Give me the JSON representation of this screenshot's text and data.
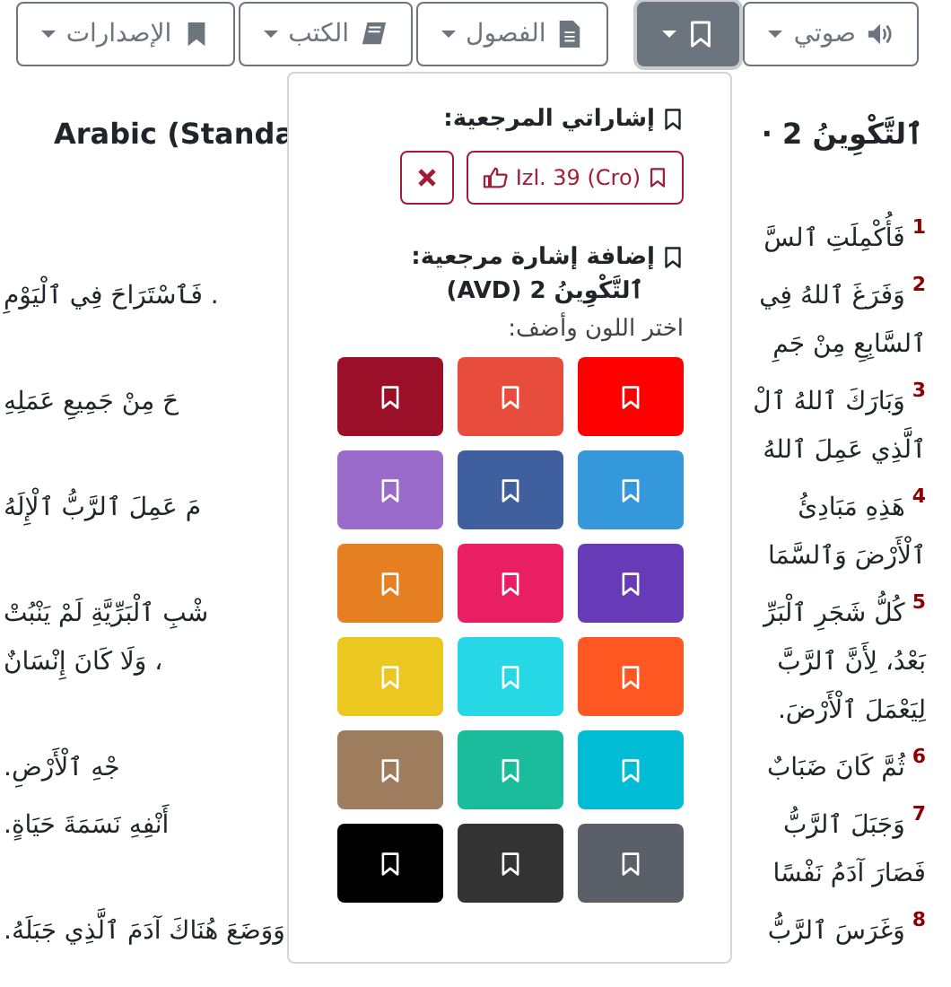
{
  "toolbar": [
    {
      "kind": "audio",
      "label": "صوتي",
      "selected": false
    },
    {
      "kind": "bookmark",
      "selected": true
    },
    {
      "kind": "chapters",
      "label": "الفصول",
      "selected": false
    },
    {
      "kind": "books",
      "label": "الكتب",
      "selected": false
    },
    {
      "kind": "versions",
      "label": "الإصدارات",
      "selected": false
    }
  ],
  "heading": {
    "reference": "ٱلتَّكْوِينُ 2 ·",
    "version": "Arabic (Standa"
  },
  "verses": [
    {
      "number": "1",
      "start": "فَأُكْمِلَتِ ٱلسَّ"
    },
    {
      "number": "2",
      "start": "وَفَرَغَ ٱللهُ فِي",
      "end": ". فَٱسْتَرَاحَ فِي ٱلْيَوْمِ"
    },
    {
      "start": "ٱلسَّابِعِ مِنْ جَمِ"
    },
    {
      "number": "3",
      "start": "وَبَارَكَ ٱللهُ ٱلْ",
      "end": "حَ مِنْ جَمِيعِ عَمَلِهِ"
    },
    {
      "start": "ٱلَّذِي عَمِلَ ٱللهُ"
    },
    {
      "number": "4",
      "start": "هَذِهِ مَبَادِئُ",
      "end": "مَ عَمِلَ ٱلرَّبُّ ٱلْإِلَهُ"
    },
    {
      "start": "ٱلْأَرْضَ وَٱلسَّمَا"
    },
    {
      "number": "5",
      "start": "كُلُّ شَجَرِ ٱلْبَرِّ",
      "end": "شْبِ ٱلْبَرِّيَّةِ لَمْ يَنْبُتْ"
    },
    {
      "start": "بَعْدُ، لِأَنَّ ٱلرَّبَّ",
      "end": "، وَلَا كَانَ إِنْسَانٌ"
    },
    {
      "start": "لِيَعْمَلَ ٱلْأَرْضَ."
    },
    {
      "number": "6",
      "start": "ثُمَّ كَانَ ضَبَابٌ",
      "end": "جْهِ ٱلْأَرْضِ."
    },
    {
      "number": "7",
      "start": "وَجَبَلَ ٱلرَّبُّ",
      "end": "أَنْفِهِ نَسَمَةَ حَيَاةٍ."
    },
    {
      "start": "فَصَارَ آدَمُ نَفْسًا"
    },
    {
      "number": "8",
      "start": "وَغَرَسَ ٱلرَّبُّ",
      "end": "وَوَضَعَ هُنَاكَ آدَمَ ٱلَّذِي جَبَلَهُ."
    }
  ],
  "bookmark_menu": {
    "my_bookmarks_title": "إشاراتي المرجعية:",
    "bookmarks": [
      {
        "label": "Izl. 39 (Cro)"
      }
    ],
    "add_title": "إضافة إشارة مرجعية:",
    "add_reference": "ٱلتَّكْوِينُ 2 (AVD)",
    "color_prompt": "اختر اللون وأضف:",
    "colors": [
      {
        "color": "#ff0000"
      },
      {
        "color": "#e74c3c"
      },
      {
        "color": "#9b1028"
      },
      {
        "color": "#3498db"
      },
      {
        "color": "#3f5f9e"
      },
      {
        "color": "#9b6bcc"
      },
      {
        "color": "#673ab7"
      },
      {
        "color": "#e91e63"
      },
      {
        "color": "#e67e22"
      },
      {
        "color": "#ff5722"
      },
      {
        "color": "#26d7e6"
      },
      {
        "color": "#ebc71f"
      },
      {
        "color": "#00bcd4"
      },
      {
        "color": "#1abc9c"
      },
      {
        "color": "#9e7d5e"
      },
      {
        "color": "#5a5f68"
      },
      {
        "color": "#333333"
      },
      {
        "color": "#000000"
      }
    ]
  }
}
